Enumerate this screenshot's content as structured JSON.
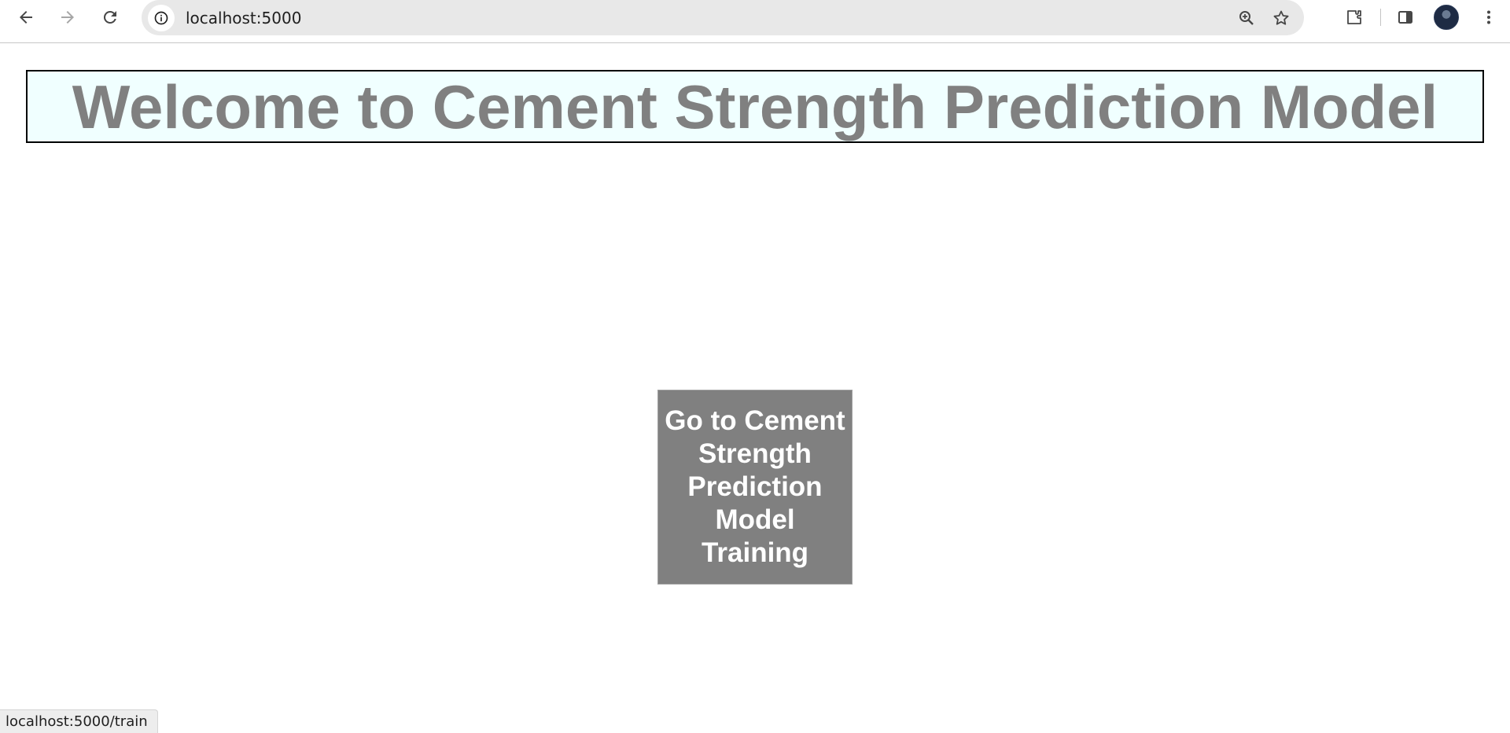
{
  "browser": {
    "url": "localhost:5000",
    "status_url": "localhost:5000/train",
    "icons": {
      "back": "arrow-left-icon",
      "forward": "arrow-right-icon",
      "reload": "reload-icon",
      "site_info": "info-icon",
      "zoom": "zoom-icon",
      "bookmark": "star-icon",
      "extensions": "puzzle-icon",
      "side_panel": "side-panel-icon",
      "menu": "kebab-menu-icon"
    }
  },
  "page": {
    "title": "Welcome to Cement Strength Prediction Model",
    "training_button_label": "Go to Cement Strength Prediction Model Training"
  },
  "colors": {
    "banner_bg": "#f0ffff",
    "title_text": "#808080",
    "button_bg": "#808080",
    "button_text": "#ffffff"
  }
}
